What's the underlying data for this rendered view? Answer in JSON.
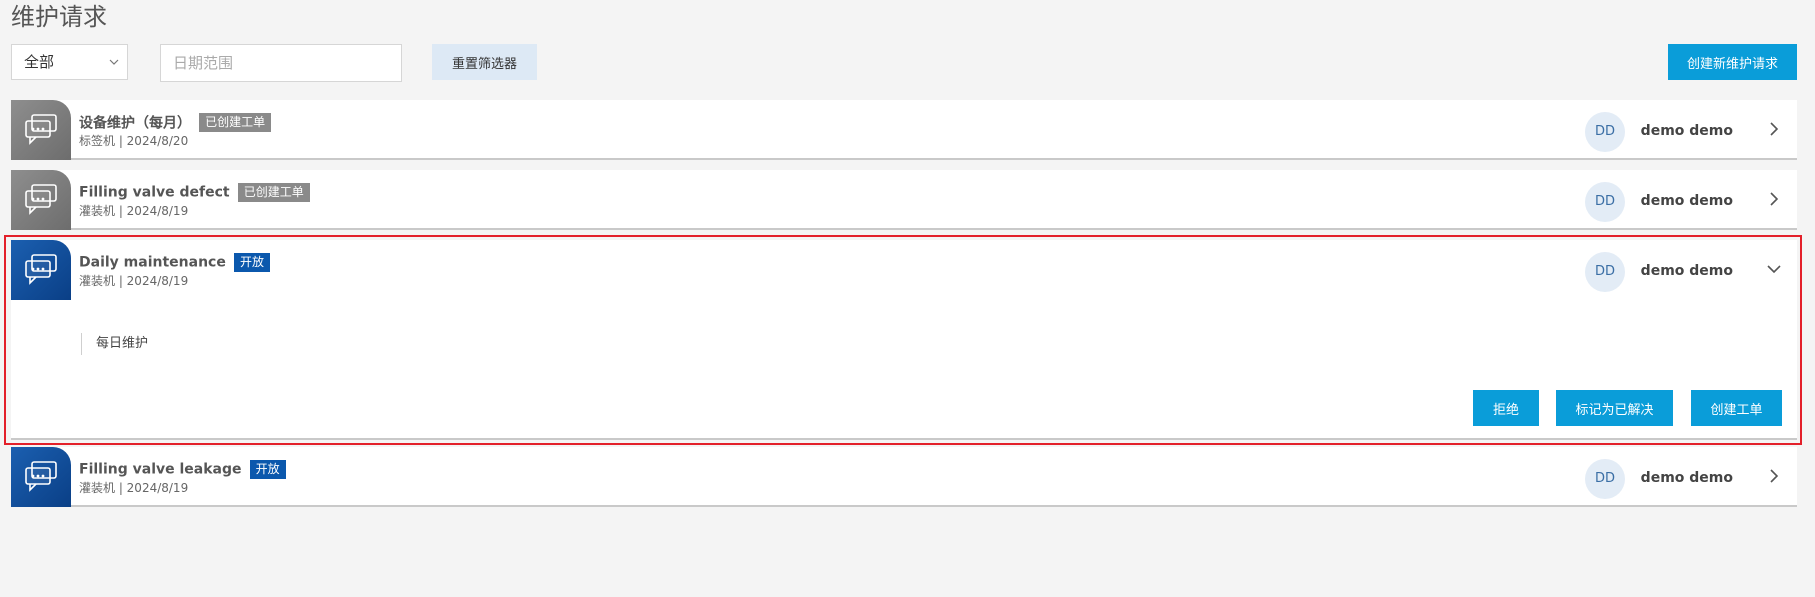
{
  "page": {
    "title": "维护请求"
  },
  "filters": {
    "status_select": "全部",
    "date_placeholder": "日期范围",
    "reset_label": "重置筛选器",
    "create_label": "创建新维护请求"
  },
  "requests": [
    {
      "title": "设备维护（每月）",
      "badge": "已创建工单",
      "badge_type": "created",
      "subtitle": "标签机 | 2024/8/20",
      "avatar": "DD",
      "user": "demo demo",
      "expanded": false
    },
    {
      "title": "Filling valve defect",
      "badge": "已创建工单",
      "badge_type": "created",
      "subtitle": "灌装机 | 2024/8/19",
      "avatar": "DD",
      "user": "demo demo",
      "expanded": false
    },
    {
      "title": "Daily maintenance",
      "badge": "开放",
      "badge_type": "open",
      "subtitle": "灌装机 | 2024/8/19",
      "avatar": "DD",
      "user": "demo demo",
      "expanded": true,
      "detail": "每日维护",
      "actions": {
        "reject": "拒绝",
        "resolve": "标记为已解决",
        "create_order": "创建工单"
      }
    },
    {
      "title": "Filling valve leakage",
      "badge": "开放",
      "badge_type": "open",
      "subtitle": "灌装机 | 2024/8/19",
      "avatar": "DD",
      "user": "demo demo",
      "expanded": false
    }
  ],
  "colors": {
    "accent": "#0a9dd9",
    "open_badge": "#0b58ad",
    "created_badge": "#8a8a8a",
    "highlight": "#e3202a"
  },
  "icons": {
    "request": "chat-bubbles-icon",
    "chevron_right": "chevron-right-icon",
    "chevron_down": "chevron-down-icon"
  }
}
